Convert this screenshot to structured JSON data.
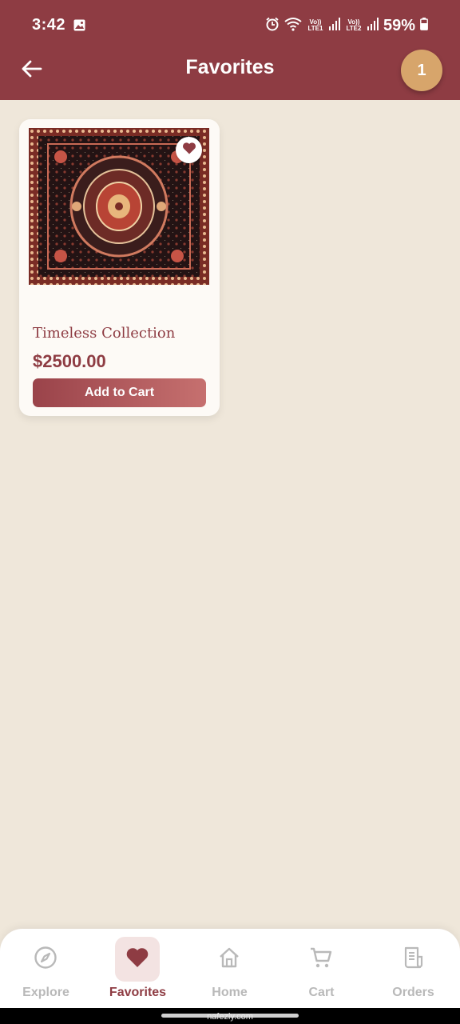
{
  "status_bar": {
    "time": "3:42",
    "sim1_label": "Vo)) LTE1",
    "sim2_label": "Vo)) LTE2",
    "battery_percent": "59%"
  },
  "app_bar": {
    "title": "Favorites",
    "badge_count": "1"
  },
  "favorites": [
    {
      "name": "Timeless Collection",
      "price": "$2500.00",
      "button_label": "Add to Cart",
      "favorited": true
    }
  ],
  "bottom_nav": {
    "items": [
      {
        "label": "Explore",
        "icon": "compass-icon",
        "active": false
      },
      {
        "label": "Favorites",
        "icon": "heart-icon",
        "active": true
      },
      {
        "label": "Home",
        "icon": "home-icon",
        "active": false
      },
      {
        "label": "Cart",
        "icon": "cart-icon",
        "active": false
      },
      {
        "label": "Orders",
        "icon": "receipt-icon",
        "active": false
      }
    ]
  },
  "watermark": "nafezly.com",
  "colors": {
    "primary": "#8e3c43",
    "background": "#efe7da",
    "badge": "#d7a56b",
    "inactive": "#b9b9b9"
  }
}
